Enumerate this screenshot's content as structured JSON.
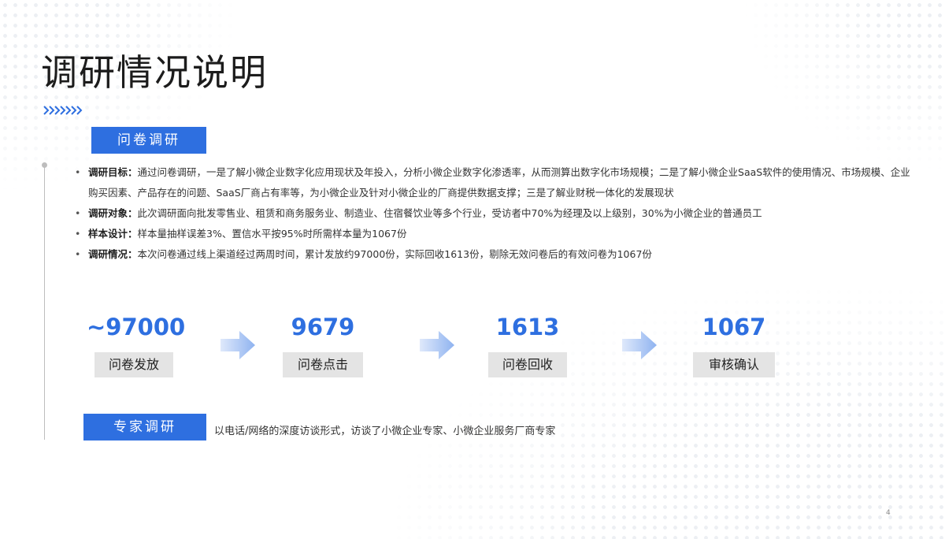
{
  "title": "调研情况说明",
  "survey_tag": "问卷调研",
  "bullets": [
    {
      "label": "调研目标：",
      "text": "通过问卷调研，一是了解小微企业数字化应用现状及年投入，分析小微企业数字化渗透率，从而测算出数字化市场规模；二是了解小微企业SaaS软件的使用情况、市场规模、企业购买因素、产品存在的问题、SaaS厂商占有率等，为小微企业及针对小微企业的厂商提供数据支撑；三是了解业财税一体化的发展现状"
    },
    {
      "label": "调研对象：",
      "text": "此次调研面向批发零售业、租赁和商务服务业、制造业、住宿餐饮业等多个行业，受访者中70%为经理及以上级别，30%为小微企业的普通员工"
    },
    {
      "label": "样本设计：",
      "text": "样本量抽样误差3%、置信水平按95%时所需样本量为1067份"
    },
    {
      "label": "调研情况：",
      "text": "本次问卷通过线上渠道经过两周时间，累计发放约97000份，实际回收1613份，剔除无效问卷后的有效问卷为1067份"
    }
  ],
  "stats": [
    {
      "value": "~97000",
      "label": "问卷发放"
    },
    {
      "value": "9679",
      "label": "问卷点击"
    },
    {
      "value": "1613",
      "label": "问卷回收"
    },
    {
      "value": "1067",
      "label": "审核确认"
    }
  ],
  "expert_tag": "专家调研",
  "expert_text": "以电话/网络的深度访谈形式，访谈了小微企业专家、小微企业服务厂商专家",
  "page_number": "4",
  "colors": {
    "accent": "#2e6fe0",
    "stat_box": "#e4e4e4",
    "arrow": "#8fb3f0"
  }
}
